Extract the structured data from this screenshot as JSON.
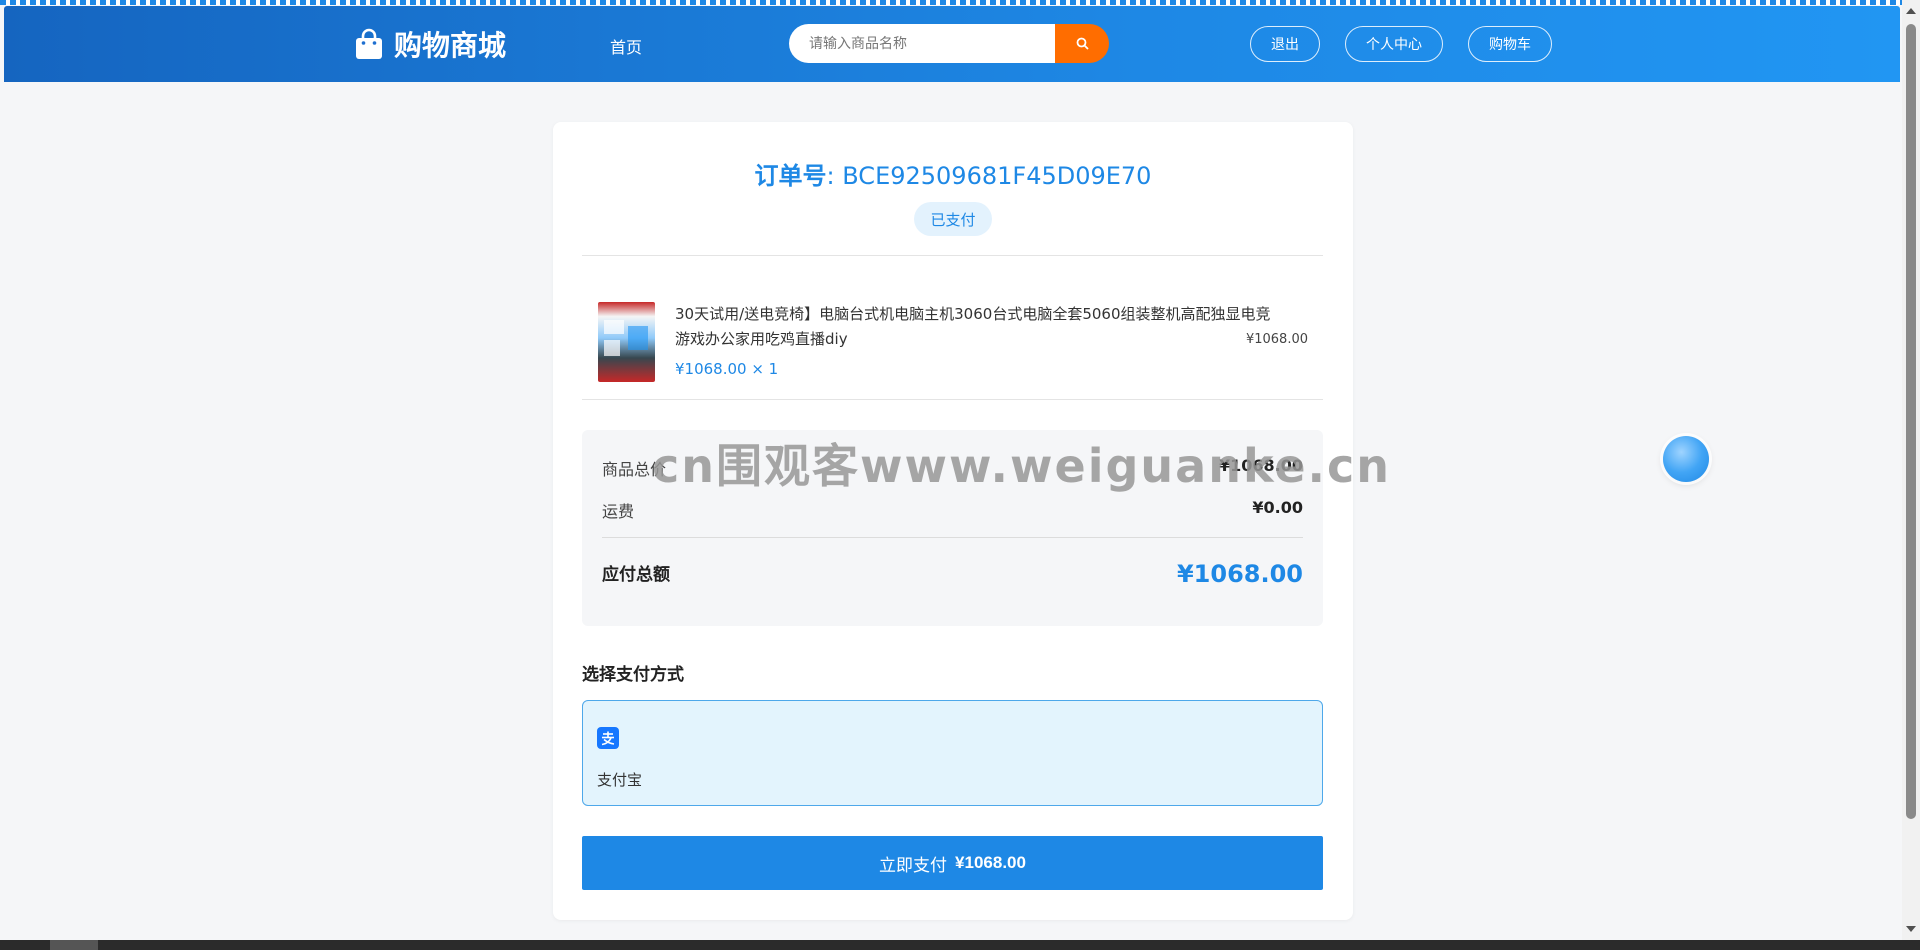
{
  "header": {
    "brand": "购物商城",
    "nav_home": "首页",
    "search_placeholder": "请输入商品名称",
    "logout": "退出",
    "profile": "个人中心",
    "cart": "购物车"
  },
  "order": {
    "number_label": "订单号",
    "number_value": ": BCE92509681F45D09E70",
    "status": "已支付"
  },
  "item": {
    "name": "30天试用/送电竞椅】电脑台式机电脑主机3060台式电脑全套5060组装整机高配独显电竞游戏办公家用吃鸡直播diy",
    "price_qty": "¥1068.00 × 1",
    "subtotal": "¥1068.00"
  },
  "summary": {
    "goods_total_label": "商品总价",
    "goods_total_value": "¥1068.00",
    "shipping_label": "运费",
    "shipping_value": "¥0.00",
    "payable_label": "应付总额",
    "payable_value": "¥1068.00"
  },
  "payment": {
    "section_title": "选择支付方式",
    "method_label": "支付宝",
    "pay_button_label": "立即支付",
    "pay_button_amount": "¥1068.00"
  },
  "watermark": "cn围观客www.weiguanke.cn",
  "colors": {
    "primary": "#1e88e5",
    "search_button": "#ff6d00",
    "selected_bg": "#e3f4fd"
  },
  "icons": {
    "brand": "shopping-bag-icon",
    "search": "search-icon",
    "alipay": "alipay-icon"
  }
}
